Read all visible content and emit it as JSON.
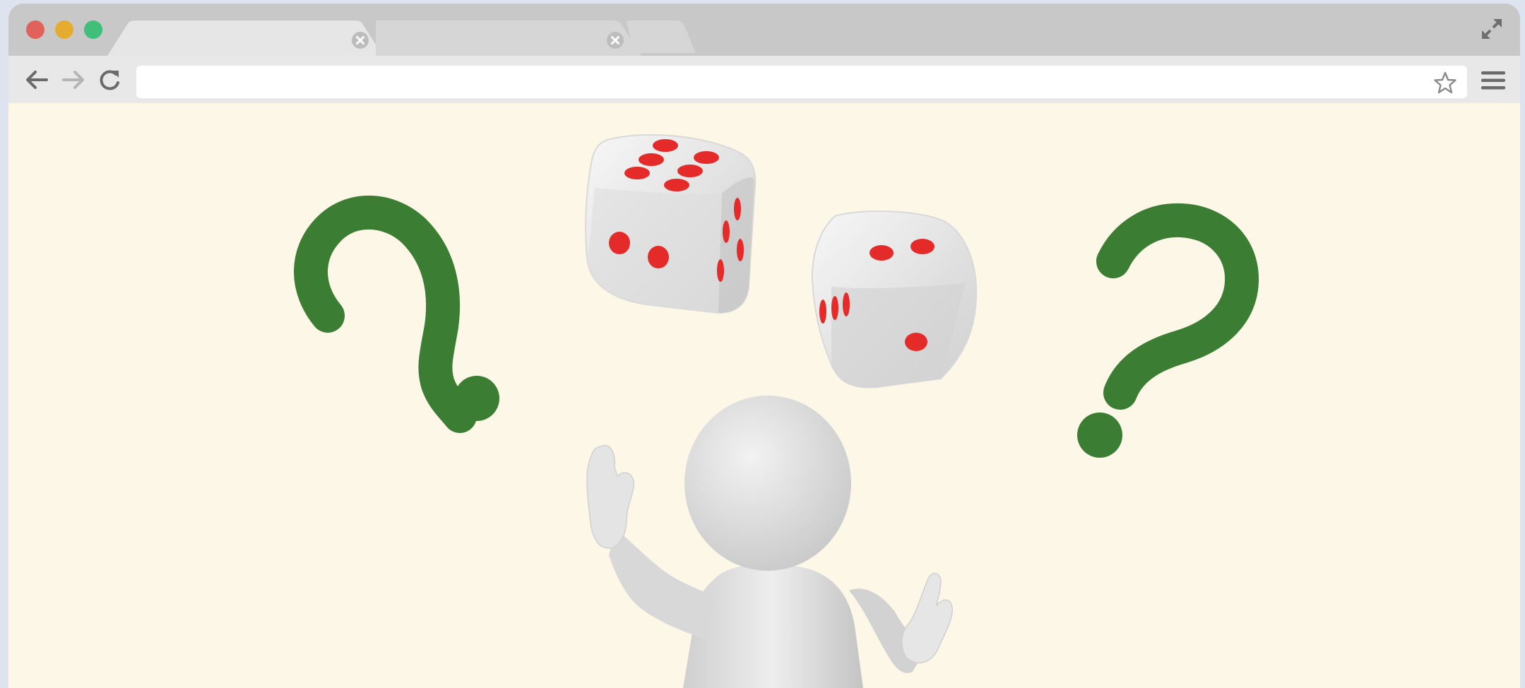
{
  "browser": {
    "tabs": [
      {
        "title": "",
        "active": true
      },
      {
        "title": "",
        "active": false
      }
    ],
    "address_bar": {
      "value": "",
      "placeholder": ""
    },
    "colors": {
      "close": "#e0625a",
      "minimize": "#e6ac30",
      "maximize": "#3fbf7a",
      "chrome": "#c8c8c8",
      "toolbar": "#e8e8e8",
      "content_bg": "#fdf7e7"
    },
    "icons": {
      "back": "arrow-left-icon",
      "forward": "arrow-right-icon",
      "reload": "reload-icon",
      "bookmark": "star-icon",
      "menu": "hamburger-menu-icon",
      "fullscreen": "expand-icon",
      "tab_close": "close-circle-icon"
    }
  },
  "illustration": {
    "subject": "3d-figure-with-dice",
    "colors": {
      "question_marks": "#3b7d33",
      "dice_pips": "#e52a2a",
      "figure": "#dcdcdc"
    }
  }
}
